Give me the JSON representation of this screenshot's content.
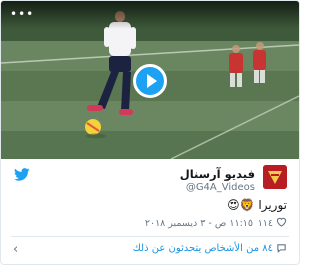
{
  "colors": {
    "twitter_blue": "#1da1f2",
    "link_blue": "#1b95e0",
    "text_primary": "#14171a",
    "text_secondary": "#657786",
    "border": "#e1e8ed",
    "pitch_green": "#5f7a57"
  },
  "media": {
    "more_label": "•••",
    "play_icon": "play-icon"
  },
  "author": {
    "display_name": "فيديو آرسنال",
    "handle": "@G4A_Videos",
    "avatar_icon": "arsenal-avatar"
  },
  "tweet": {
    "text": "توريرا 🦁😍"
  },
  "meta": {
    "like_icon": "heart-icon",
    "likes": "١١٤",
    "timestamp": "١١:١٥ ص - ٣ ديسمبر ٢٠١٨"
  },
  "footer": {
    "reply_icon": "speech-bubble-icon",
    "text": "٨٤ من الأشخاص يتحدثون عن ذلك",
    "chevron": "‹"
  }
}
